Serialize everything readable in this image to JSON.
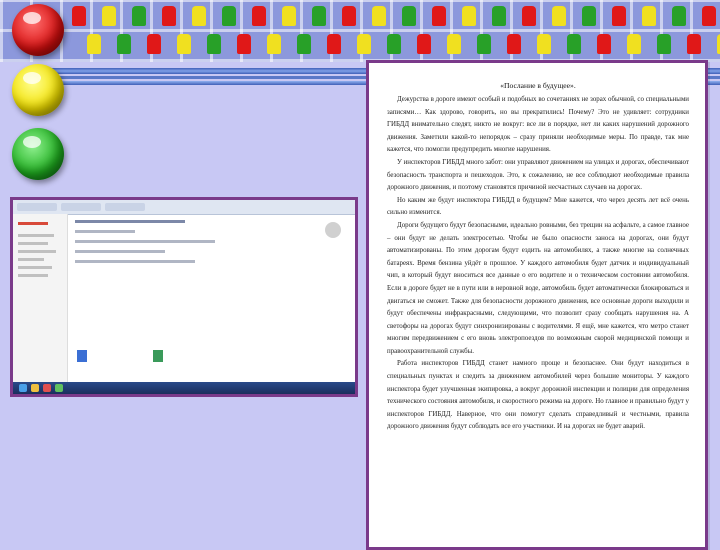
{
  "decor": {
    "lights": [
      "red",
      "yellow",
      "green"
    ],
    "band_color": "#8c98dc",
    "frame_color": "#7a3a8a",
    "background_color": "#c8c8f4"
  },
  "document": {
    "title": "«Послание в будущее».",
    "paragraphs": [
      "Дежурства в дороге имеют особый и подобных во сочетаниях не зорах обычной, со специальными записями… Как здорово, говорить, но вы прекратились! Почему? Это не удивляет: сотрудники ГИБДД внимательно следят, никто не вокруг: все ли в порядке, нет ли каких нарушений дорожного движения. Заметили какой-то непорядок – сразу приняли необходимые меры. По правде, так мне кажется, что помогли предупредить многие нарушения.",
      "У инспекторов ГИБДД много забот: они управляют движением на улицах и дорогах, обеспечивают безопасность транспорта и пешеходов. Это, к сожалению, не все соблюдают необходимые правила дорожного движения, и поэтому становятся причиной несчастных случаев на дорогах.",
      "Но каким же будут инспектора ГИБДД в будущем? Мне кажется, что через десять лет всё очень сильно изменится.",
      "Дороги будущего будут безопасными, идеально ровными, без трещин на асфальте, а самое главное – они будут не делать электросетью. Чтобы не было опасности заноса на дорогах, они будут автоматизированы. По этим дорогам будут ездить на автомобилях, а также многие на солнечных батареях. Время бензина уйдёт в прошлое. У каждого автомобиля будет датчик и индивидуальный чип, в который будут вноситься все данные о его водителе и о техническом состоянии автомобиля. Если в дороге будет не в пути или в неровной воде, автомобиль будет автоматически блокироваться и двигаться не сможет. Также для безопасности дорожного движения, все основные дороги выходили и будут обеспечены инфракрасными, следующими, что позволит сразу сообщать нарушения на. А светофоры на дорогах будут синхронизированы с водителями. Я ещё, мне кажется, что метро станет многим передвижением с его вновь электропоездов по возможным скорой медицинской помощи и правоохранительной службы.",
      "Работа инспекторов ГИБДД станет намного проще и безопаснее. Они будут находиться в специальных пунктах и следить за движением автомобилей через большие мониторы. У каждого инспектора будет улучшенная экипировка, а вокруг дорожной инспекции и полиции для определения технического состояния автомобиля, и скоростного режима на дороге. Но главное и правильно будут у инспекторов ГИБДД. Наверное, что они помогут сделать справедливый и честными, правила дорожного движения будут соблюдать все его участники. И на дорогах не будет аварий."
    ]
  }
}
